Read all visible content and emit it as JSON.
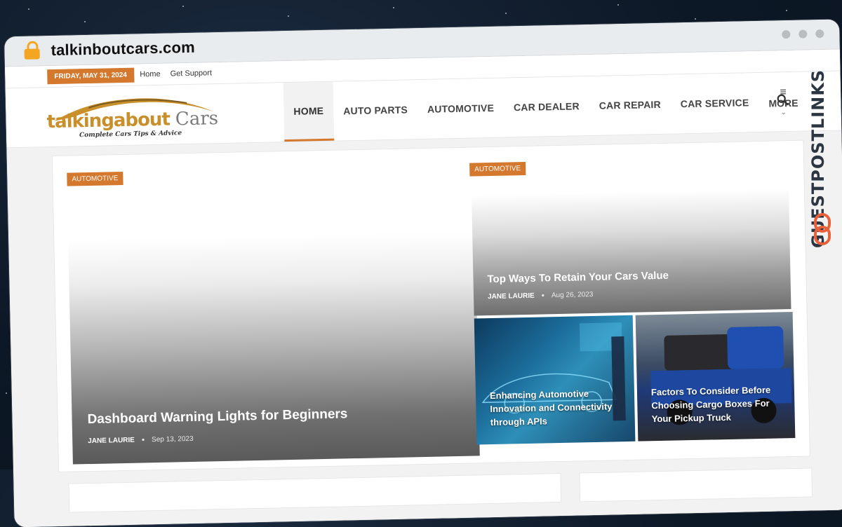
{
  "browser": {
    "url": "talkinboutcars.com"
  },
  "topbar": {
    "date": "FRIDAY, MAY 31, 2024",
    "links": [
      "Home",
      "Get Support"
    ]
  },
  "logo": {
    "text_a": "talkingabout",
    "text_b": "Cars",
    "tagline": "Complete Cars Tips & Advice"
  },
  "nav": {
    "items": [
      "HOME",
      "AUTO PARTS",
      "AUTOMOTIVE",
      "CAR DEALER",
      "CAR REPAIR",
      "CAR SERVICE"
    ],
    "more_label": "MORE"
  },
  "featured": {
    "main": {
      "category": "AUTOMOTIVE",
      "title": "Dashboard Warning Lights for Beginners",
      "author": "JANE LAURIE",
      "date": "Sep 13, 2023"
    },
    "top_right": {
      "category": "AUTOMOTIVE",
      "title": "Top Ways To Retain Your Cars Value",
      "author": "JANE LAURIE",
      "date": "Aug 26, 2023"
    },
    "thumbs": [
      {
        "title": "Enhancing Automotive Innovation and Connectivity through APIs"
      },
      {
        "title": "Factors To Consider Before Choosing Cargo Boxes For Your Pickup Truck"
      }
    ]
  },
  "watermark": {
    "text": "GUESTPOSTLINKS"
  },
  "colors": {
    "accent": "#d4782e",
    "lock": "#f4a623",
    "background": "#0d1826"
  }
}
